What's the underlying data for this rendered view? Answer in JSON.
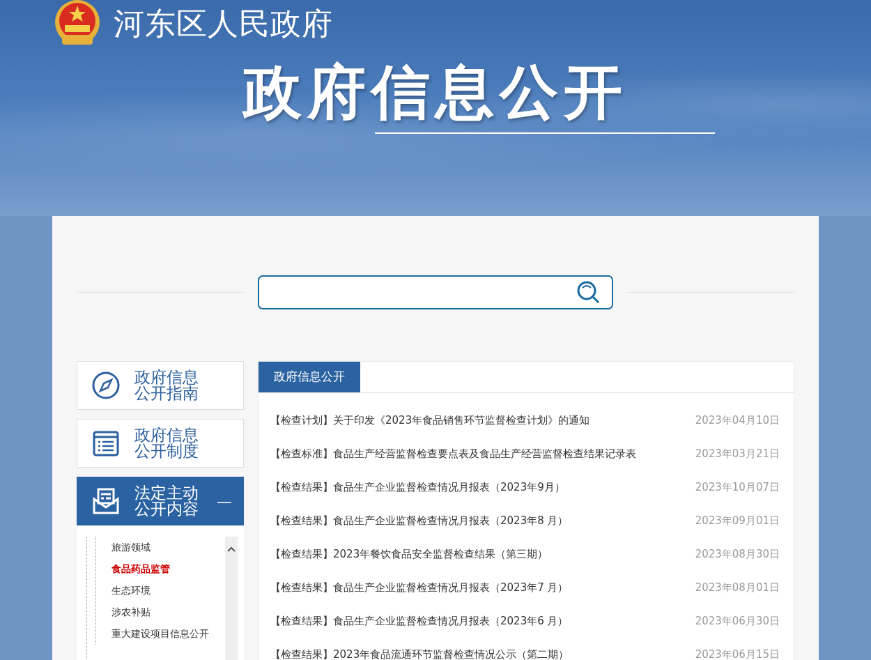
{
  "header": {
    "site_name": "河东区人民政府",
    "title": "政府信息公开"
  },
  "sidebar": {
    "items": [
      {
        "kind": "guide",
        "label_lines": [
          "政府信息",
          "公开指南"
        ],
        "expanded": false
      },
      {
        "kind": "rules",
        "label_lines": [
          "政府信息",
          "公开制度"
        ],
        "expanded": false
      },
      {
        "kind": "content",
        "label_lines": [
          "法定主动",
          "公开内容"
        ],
        "expanded": true,
        "toggle": "—"
      }
    ],
    "tree": [
      {
        "label": "旅游领域",
        "selected": false
      },
      {
        "label": "食品药品监管",
        "selected": true
      },
      {
        "label": "生态环境",
        "selected": false
      },
      {
        "label": "涉农补贴",
        "selected": false
      },
      {
        "label": "重大建设项目信息公开",
        "selected": false
      }
    ]
  },
  "panel": {
    "tab": "政府信息公开",
    "rows": [
      {
        "title": "【检查计划】关于印发《2023年食品销售环节监督检查计划》的通知",
        "date": "2023年04月10日"
      },
      {
        "title": "【检查标准】食品生产经营监督检查要点表及食品生产经营监督检查结果记录表",
        "date": "2023年03月21日"
      },
      {
        "title": "【检查结果】食品生产企业监督检查情况月报表（2023年9月）",
        "date": "2023年10月07日"
      },
      {
        "title": "【检查结果】食品生产企业监督检查情况月报表（2023年8 月）",
        "date": "2023年09月01日"
      },
      {
        "title": "【检查结果】2023年餐饮食品安全监督检查结果（第三期）",
        "date": "2023年08月30日"
      },
      {
        "title": "【检查结果】食品生产企业监督检查情况月报表（2023年7 月）",
        "date": "2023年08月01日"
      },
      {
        "title": "【检查结果】食品生产企业监督检查情况月报表（2023年6 月）",
        "date": "2023年06月30日"
      },
      {
        "title": "【检查结果】2023年食品流通环节监督检查情况公示（第二期）",
        "date": "2023年06月15日"
      }
    ]
  }
}
